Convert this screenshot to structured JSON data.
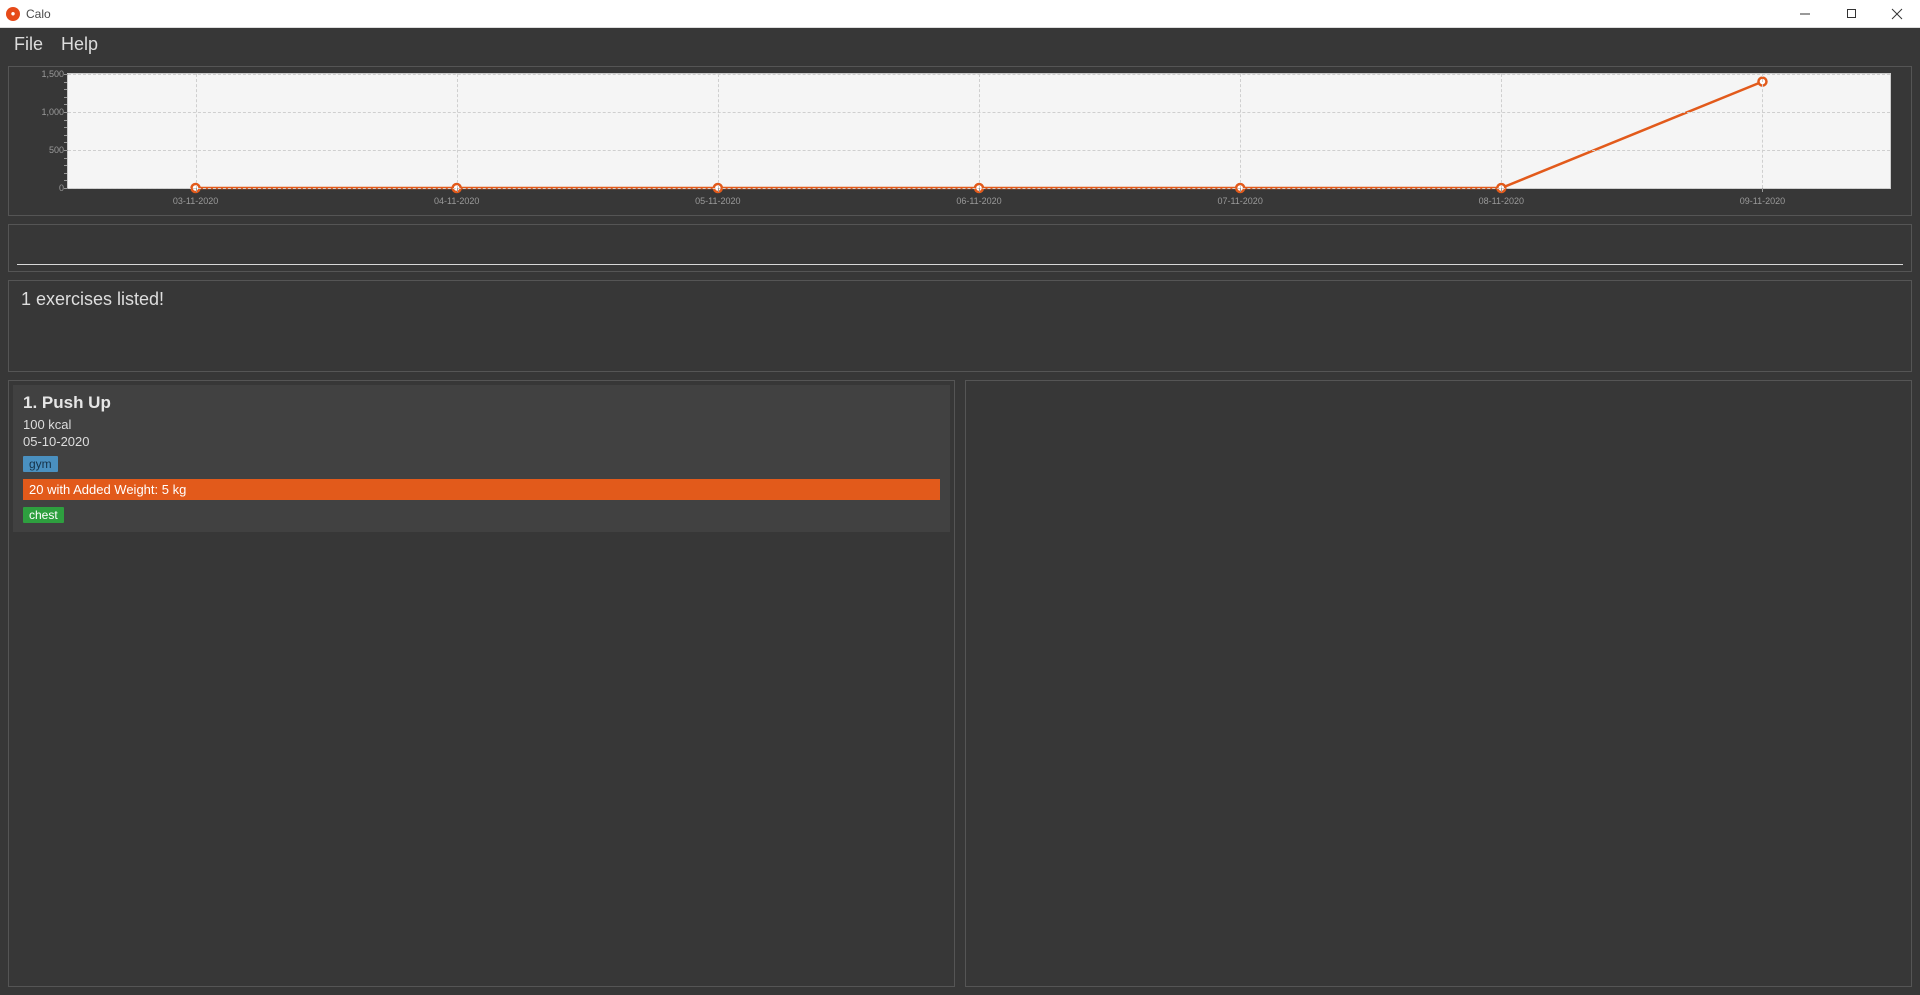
{
  "window": {
    "title": "Calo"
  },
  "menu": {
    "file": "File",
    "help": "Help"
  },
  "chart_data": {
    "type": "line",
    "title": "",
    "xlabel": "",
    "ylabel": "",
    "categories": [
      "03-11-2020",
      "04-11-2020",
      "05-11-2020",
      "06-11-2020",
      "07-11-2020",
      "08-11-2020",
      "09-11-2020"
    ],
    "values": [
      0,
      0,
      0,
      0,
      0,
      0,
      1400
    ],
    "y_ticks": [
      0,
      500,
      1000,
      1500
    ],
    "ylim": [
      0,
      1500
    ],
    "color": "#e25a1b"
  },
  "command": {
    "value": ""
  },
  "result": {
    "message": "1 exercises listed!"
  },
  "exercises": [
    {
      "index": "1.",
      "name": "Push Up",
      "calories_value": "100",
      "calories_unit": "kcal",
      "date": "05-10-2020",
      "location_tag": "gym",
      "sets_description": "20 with Added Weight: 5 kg",
      "muscle_tag": "chest"
    }
  ],
  "colors": {
    "accent": "#e25a1b",
    "tag_location": "#4a90c0",
    "tag_muscle": "#2e9f3f",
    "panel_bg": "#373737",
    "card_bg": "#414141"
  }
}
